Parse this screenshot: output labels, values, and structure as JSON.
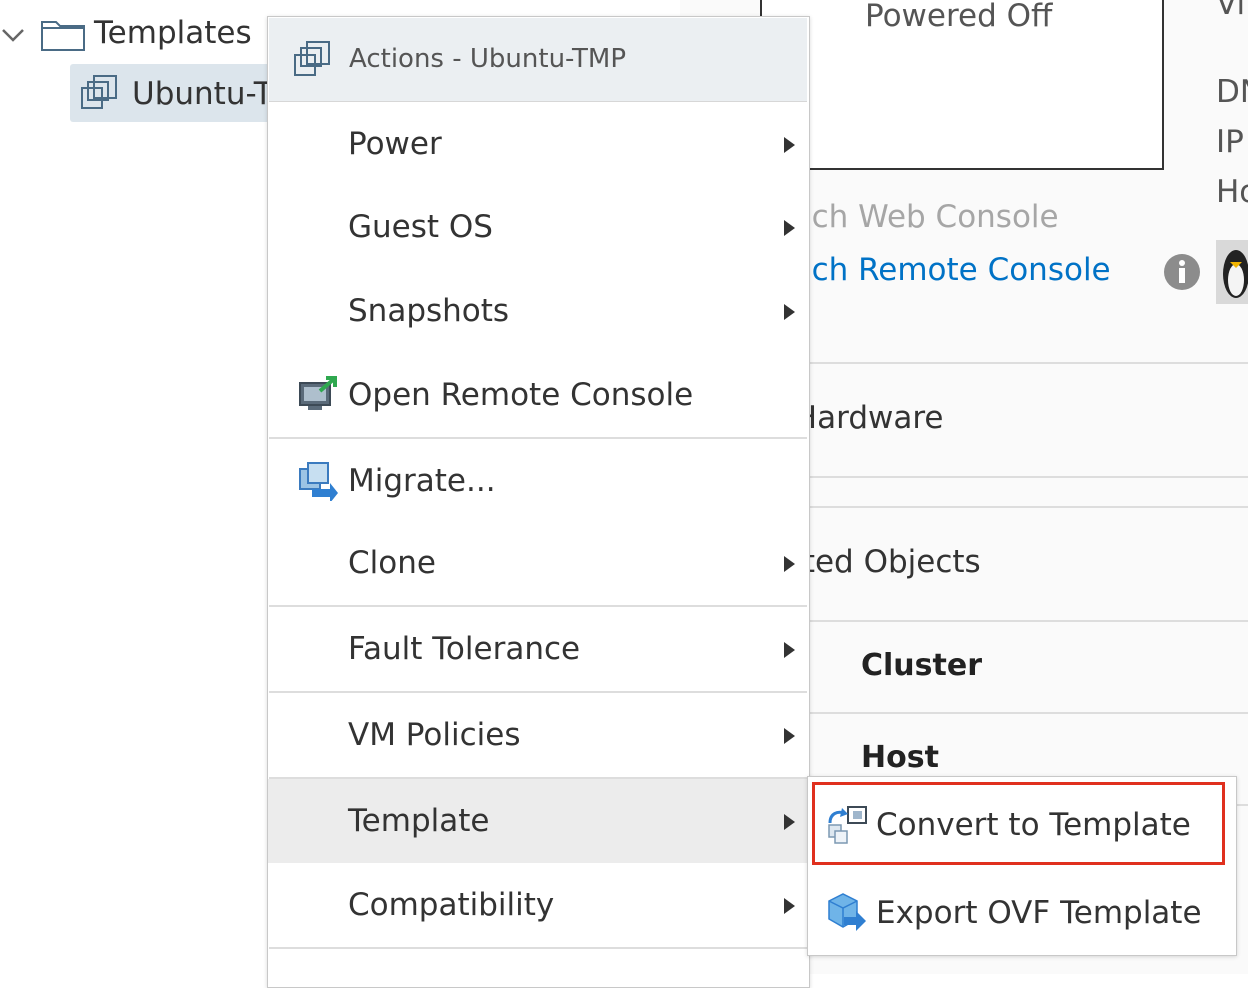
{
  "tree": {
    "templates_label": "Templates",
    "vm_label": "Ubuntu-TMP"
  },
  "detail": {
    "power_state": "Powered Off",
    "info_labels": [
      "Vi",
      "DN",
      "IP",
      "Ho"
    ],
    "launch_web_console": "Launch Web Console",
    "launch_remote_console": "Launch Remote Console",
    "vm_hardware_title": "VM Hardware",
    "related_objects_title": "Related Objects",
    "cluster_label": "Cluster",
    "host_label": "Host"
  },
  "menu": {
    "header": "Actions - Ubuntu-TMP",
    "items": [
      {
        "label": "Power"
      },
      {
        "label": "Guest OS"
      },
      {
        "label": "Snapshots"
      },
      {
        "label": "Open Remote Console"
      },
      {
        "label": "Migrate..."
      },
      {
        "label": "Clone"
      },
      {
        "label": "Fault Tolerance"
      },
      {
        "label": "VM Policies"
      },
      {
        "label": "Template"
      },
      {
        "label": "Compatibility"
      }
    ]
  },
  "submenu": {
    "items": [
      {
        "label": "Convert to Template"
      },
      {
        "label": "Export OVF Template"
      }
    ]
  },
  "colors": {
    "link": "#0072c6",
    "highlight_border": "#e0301e",
    "menu_header_bg": "#ebeff2",
    "hover_bg": "#ececec",
    "tree_selected_bg": "#dce5ec"
  },
  "icons": {
    "tree_chevron": "chevron-down-icon",
    "templates": "folder-icon",
    "vm": "vm-template-icon",
    "menu_header": "vm-template-icon",
    "open_remote_console": "remote-console-icon",
    "migrate": "migrate-icon",
    "convert_to_template": "convert-template-icon",
    "export_ovf": "export-ovf-icon",
    "info": "info-icon",
    "os": "linux-tux-icon"
  }
}
